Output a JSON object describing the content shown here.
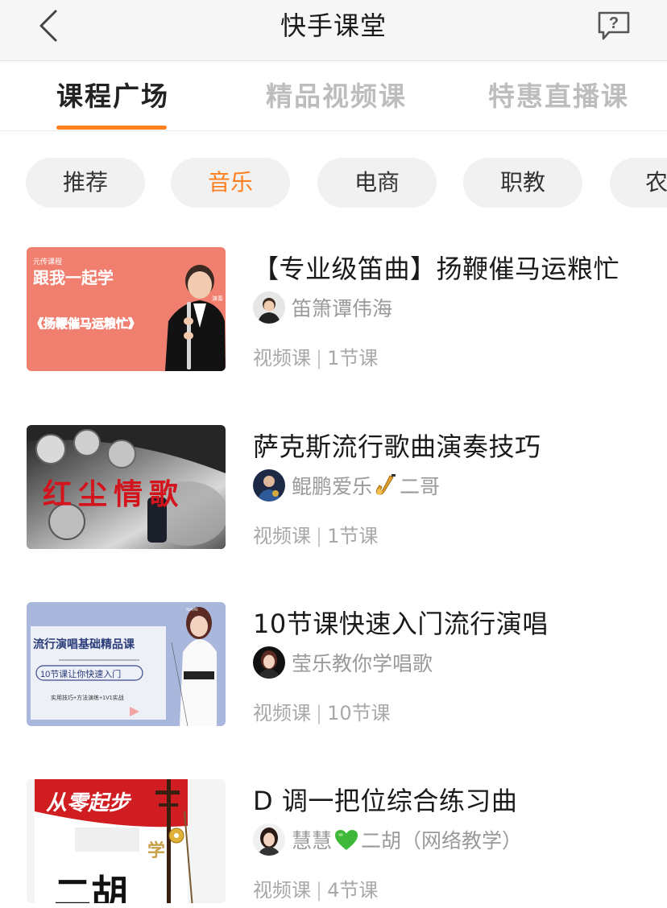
{
  "nav": {
    "title": "快手课堂"
  },
  "tabs": [
    {
      "label": "课程广场",
      "active": true
    },
    {
      "label": "精品视频课",
      "active": false
    },
    {
      "label": "特惠直播课",
      "active": false
    }
  ],
  "chips": [
    {
      "label": "推荐",
      "active": false
    },
    {
      "label": "音乐",
      "active": true
    },
    {
      "label": "电商",
      "active": false
    },
    {
      "label": "职教",
      "active": false
    },
    {
      "label": "农",
      "active": false
    }
  ],
  "courses": [
    {
      "title": "【专业级笛曲】扬鞭催马运粮忙",
      "author": "笛箫谭伟海",
      "type": "视频课",
      "lessons": "1节课",
      "thumb": {
        "tag": "元传课程",
        "line1": "跟我一起学",
        "line2": "《扬鞭催马运粮忙》",
        "badge": "演奏"
      }
    },
    {
      "title": "萨克斯流行歌曲演奏技巧",
      "author_pre": "鲲鹏爱乐",
      "author_emoji": "saxophone-icon",
      "author_post": "二哥",
      "type": "视频课",
      "lessons": "1节课",
      "thumb": {
        "overlay": "红尘情歌"
      }
    },
    {
      "title": "10节课快速入门流行演唱",
      "author": "莹乐教你学唱歌",
      "type": "视频课",
      "lessons": "10节课",
      "thumb": {
        "line1": "流行演唱基础精品课",
        "line2": "10节课让你快速入门",
        "line3": "实用技巧+方法演练+1V1实战"
      }
    },
    {
      "title": "D 调一把位综合练习曲",
      "author_pre": "慧慧",
      "author_emoji": "green-heart-icon",
      "author_post": "二胡（网络教学）",
      "type": "视频课",
      "lessons": "4节课",
      "thumb": {
        "line1": "从零起步",
        "line2": "学",
        "line3": "二胡"
      }
    }
  ],
  "colors": {
    "accent": "#ff7f1f",
    "muted": "#9a9a9a",
    "chip_bg": "#f1f1f1"
  }
}
